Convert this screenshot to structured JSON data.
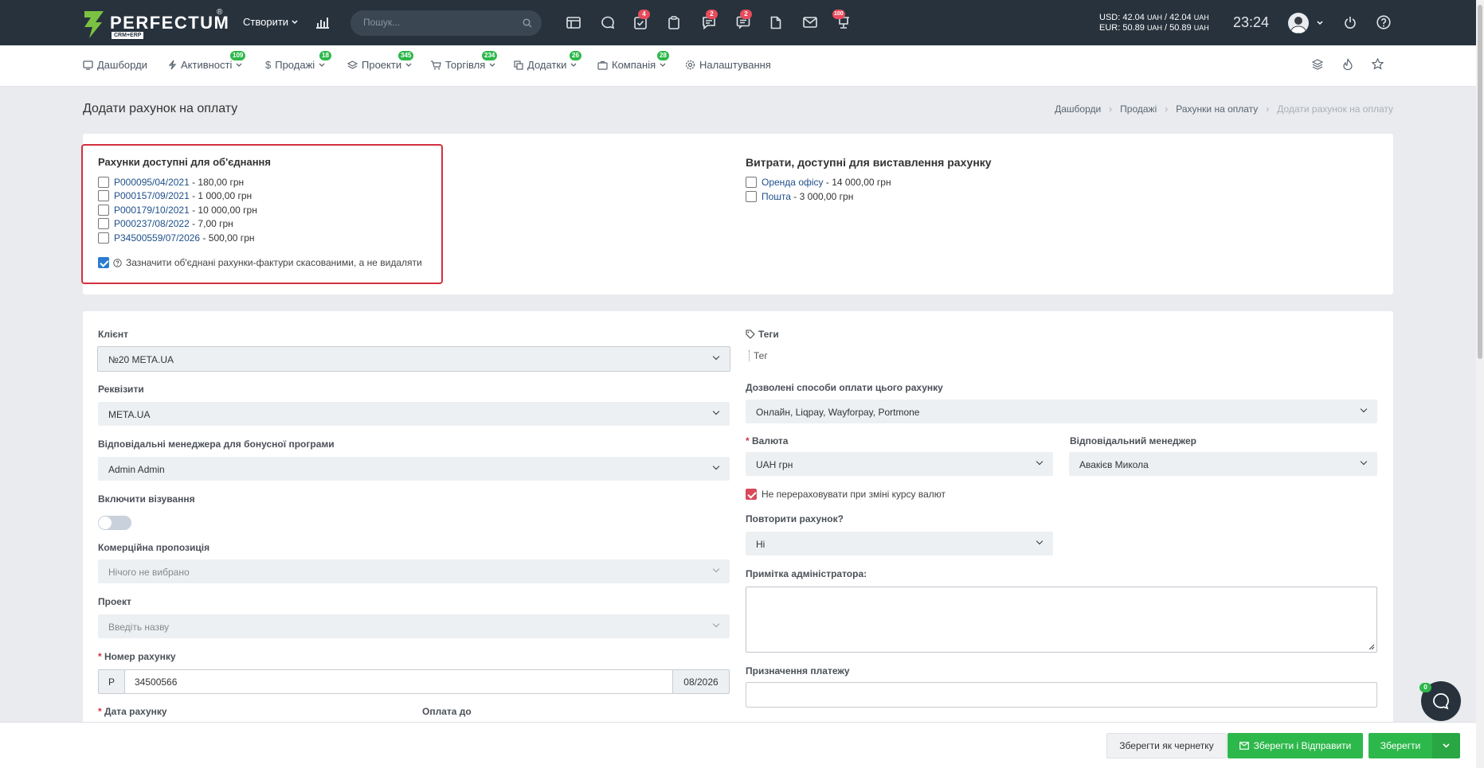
{
  "topbar": {
    "logo_text": "PERFECTUM",
    "logo_reg": "®",
    "logo_sub": "CRM+ERP",
    "create_label": "Створити",
    "search_placeholder": "Пошук...",
    "badges": {
      "tasks": "4",
      "support": "2",
      "chat": "2",
      "notifications": "100"
    },
    "currency_usd": "USD: 42.04",
    "currency_usd_unit1": "UAH",
    "currency_usd_mid": " / 42.04 ",
    "currency_usd_unit2": "UAH",
    "currency_eur": "EUR: 50.89",
    "currency_eur_unit1": "UAH",
    "currency_eur_mid": " / 50.89 ",
    "currency_eur_unit2": "UAH",
    "clock": "23:24"
  },
  "nav": {
    "items": [
      {
        "label": "Дашборди",
        "badge": ""
      },
      {
        "label": "Активності",
        "badge": "109"
      },
      {
        "label": "Продажі",
        "badge": "18"
      },
      {
        "label": "Проекти",
        "badge": "345"
      },
      {
        "label": "Торгівля",
        "badge": "234"
      },
      {
        "label": "Додатки",
        "badge": "26"
      },
      {
        "label": "Компанія",
        "badge": "28"
      },
      {
        "label": "Налаштування",
        "badge": ""
      }
    ]
  },
  "page": {
    "title": "Додати рахунок на оплату",
    "breadcrumbs": [
      "Дашборди",
      "Продажі",
      "Рахунки на оплату",
      "Додати рахунок на оплату"
    ]
  },
  "merge": {
    "title": "Рахунки доступні для об'єднання",
    "invoices": [
      {
        "number": "P000095/04/2021",
        "amount": " - 180,00 грн"
      },
      {
        "number": "P000157/09/2021",
        "amount": " - 1 000,00 грн"
      },
      {
        "number": "P000179/10/2021",
        "amount": " - 10 000,00 грн"
      },
      {
        "number": "P000237/08/2022",
        "amount": " - 7,00 грн"
      },
      {
        "number": "P34500559/07/2026",
        "amount": " - 500,00 грн"
      }
    ],
    "cancel_label": "Зазначити об'єднані рахунки-фактури скасованими, а не видаляти"
  },
  "expenses": {
    "title": "Витрати, доступні для виставлення рахунку",
    "items": [
      {
        "name": "Оренда офісу",
        "amount": " - 14 000,00 грн"
      },
      {
        "name": "Пошта",
        "amount": " - 3 000,00 грн"
      }
    ]
  },
  "form": {
    "client_label": "Клієнт",
    "client_value": "№20 META.UA",
    "requisites_label": "Реквізити",
    "requisites_value": "META.UA",
    "bonus_manager_label": "Відповідальні менеджера для бонусної програми",
    "bonus_manager_value": "Admin Admin",
    "visa_label": "Включити візування",
    "proposal_label": "Комерційна пропозиція",
    "proposal_value": "Нічого не вибрано",
    "project_label": "Проект",
    "project_value": "Введіть назву",
    "number_label": "Номер рахунку",
    "number_prefix": "P",
    "number_value": "34500566",
    "number_suffix": "08/2026",
    "date_label": "Дата рахунку",
    "due_label": "Оплата до",
    "tags_label": "Теги",
    "tags_placeholder": "Тег",
    "payment_methods_label": "Дозволені способи оплати цього рахунку",
    "payment_methods_value": "Онлайн, Liqpay, Wayforpay, Portmone",
    "currency_label": "Валюта",
    "currency_value": "UAH грн",
    "manager_label": "Відповідальний менеджер",
    "manager_value": "Авакієв Микола",
    "no_recalc_label": "Не перераховувати при зміні курсу валют",
    "repeat_label": "Повторити рахунок?",
    "repeat_value": "Ні",
    "admin_note_label": "Примітка адміністратора:",
    "purpose_label": "Призначення платежу"
  },
  "footer": {
    "draft_label": "Зберегти як чернетку",
    "save_send_label": "Зберегти і Відправити",
    "save_label": "Зберегти"
  },
  "chat_badge": "0",
  "colors": {
    "topbar": "#27323d",
    "accent_green": "#2db84b",
    "accent_red": "#e74c5c",
    "highlight_border": "#d3303f"
  }
}
